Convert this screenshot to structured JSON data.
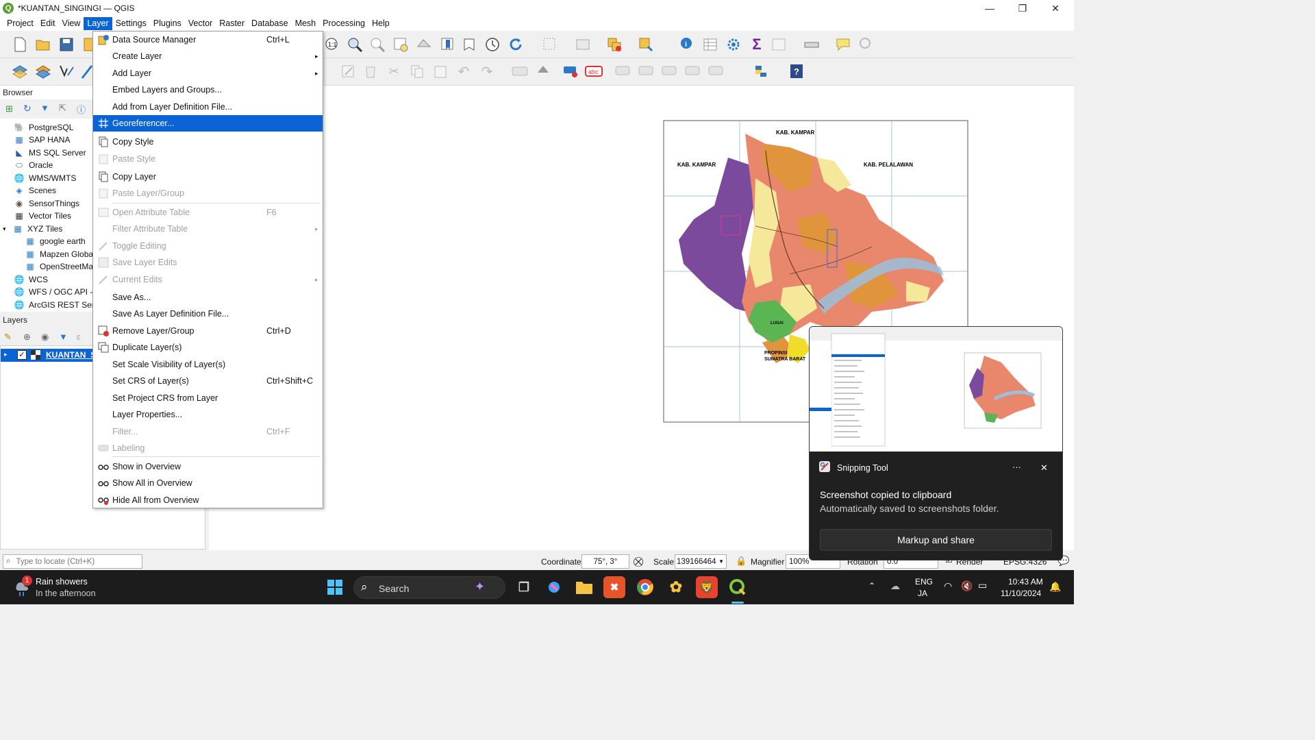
{
  "window": {
    "title": "*KUANTAN_SINGINGI — QGIS",
    "min": "—",
    "max": "❐",
    "close": "✕"
  },
  "menubar": [
    "Project",
    "Edit",
    "View",
    "Layer",
    "Settings",
    "Plugins",
    "Vector",
    "Raster",
    "Database",
    "Mesh",
    "Processing",
    "Help"
  ],
  "browser": {
    "title": "Browser",
    "items": [
      {
        "label": "PostgreSQL",
        "icon": "elephant-icon"
      },
      {
        "label": "SAP HANA",
        "icon": "database-icon"
      },
      {
        "label": "MS SQL Server",
        "icon": "database-icon"
      },
      {
        "label": "Oracle",
        "icon": "database-icon"
      },
      {
        "label": "WMS/WMTS",
        "icon": "globe-icon"
      },
      {
        "label": "Scenes",
        "icon": "scene-icon"
      },
      {
        "label": "SensorThings",
        "icon": "sensor-icon"
      },
      {
        "label": "Vector Tiles",
        "icon": "grid-icon"
      },
      {
        "label": "XYZ Tiles",
        "icon": "grid-icon"
      },
      {
        "label": "google earth",
        "icon": "grid-icon"
      },
      {
        "label": "Mapzen Globa",
        "icon": "grid-icon"
      },
      {
        "label": "OpenStreetMa",
        "icon": "grid-icon"
      },
      {
        "label": "WCS",
        "icon": "globe-icon"
      },
      {
        "label": "WFS / OGC API -",
        "icon": "globe-icon"
      },
      {
        "label": "ArcGIS REST Serv",
        "icon": "globe-icon"
      }
    ]
  },
  "layers": {
    "title": "Layers",
    "layer_name": "KUANTAN_S"
  },
  "layer_menu": {
    "items": [
      {
        "label": "Data Source Manager",
        "shortcut": "Ctrl+L",
        "icon": "data-source-icon"
      },
      {
        "label": "Create Layer",
        "submenu": "▸"
      },
      {
        "label": "Add Layer",
        "submenu": "▸"
      },
      {
        "label": "Embed Layers and Groups..."
      },
      {
        "label": "Add from Layer Definition File..."
      },
      {
        "label": "Georeferencer...",
        "highlight": true,
        "icon": "georeferencer-icon"
      },
      {
        "label": "Copy Style",
        "icon": "copy-icon"
      },
      {
        "label": "Paste Style",
        "disabled": true,
        "icon": "paste-icon"
      },
      {
        "label": "Copy Layer",
        "icon": "copy-icon"
      },
      {
        "label": "Paste Layer/Group",
        "disabled": true,
        "icon": "paste-icon"
      },
      {
        "label": "Open Attribute Table",
        "shortcut": "F6",
        "disabled": true,
        "icon": "table-icon"
      },
      {
        "label": "Filter Attribute Table",
        "submenu": "▸",
        "disabled": true
      },
      {
        "label": "Toggle Editing",
        "disabled": true,
        "icon": "pencil-icon"
      },
      {
        "label": "Save Layer Edits",
        "disabled": true,
        "icon": "save-icon"
      },
      {
        "label": "Current Edits",
        "submenu": "▸",
        "disabled": true,
        "icon": "pencil-icon"
      },
      {
        "label": "Save As..."
      },
      {
        "label": "Save As Layer Definition File..."
      },
      {
        "label": "Remove Layer/Group",
        "shortcut": "Ctrl+D",
        "icon": "remove-layer-icon"
      },
      {
        "label": "Duplicate Layer(s)",
        "icon": "duplicate-icon"
      },
      {
        "label": "Set Scale Visibility of Layer(s)"
      },
      {
        "label": "Set CRS of Layer(s)",
        "shortcut": "Ctrl+Shift+C"
      },
      {
        "label": "Set Project CRS from Layer"
      },
      {
        "label": "Layer Properties..."
      },
      {
        "label": "Filter...",
        "shortcut": "Ctrl+F",
        "disabled": true
      },
      {
        "label": "Labeling",
        "disabled": true,
        "icon": "labeling-icon"
      },
      {
        "label": "Show in Overview",
        "icon": "overview-icon"
      },
      {
        "label": "Show All in Overview",
        "icon": "overview-icon"
      },
      {
        "label": "Hide All from Overview",
        "icon": "overview-hide-icon"
      }
    ]
  },
  "map": {
    "labels": {
      "kab_kampar_1": "KAB. KAMPAR",
      "kab_kampar_2": "KAB. KAMPAR",
      "kab_pelalawan": "KAB. PELALAWAN",
      "propinsi_1": "PROPINSI",
      "propinsi_2": "SUMATRA BARAT",
      "ling": "LUGAI"
    }
  },
  "statusbar": {
    "locate_placeholder": "Type to locate (Ctrl+K)",
    "coordinate_label": "Coordinate",
    "coordinate_value": "75°, 3°",
    "scale_label": "Scale",
    "scale_value": "139166464",
    "magnifier_label": "Magnifier",
    "magnifier_value": "100%",
    "rotation_label": "Rotation",
    "rotation_value": "0.0 °",
    "render_label": "Render",
    "crs": "EPSG:4326"
  },
  "snipping_toast": {
    "app_name": "Snipping Tool",
    "more": "···",
    "close": "✕",
    "headline": "Screenshot copied to clipboard",
    "subtext": "Automatically saved to screenshots folder.",
    "action_button": "Markup and share"
  },
  "taskbar": {
    "weather_badge": "1",
    "weather_title": "Rain showers",
    "weather_sub": "In the afternoon",
    "search_label": "Search",
    "lang_top": "ENG",
    "lang_bottom": "JA",
    "time": "10:43 AM",
    "date": "11/10/2024"
  },
  "colors": {
    "accent": "#0a64d6",
    "map_purple": "#7b4a9c",
    "map_salmon": "#e8876b",
    "map_orange": "#e0953c",
    "map_yellow": "#f5e89a",
    "map_green": "#5ab552",
    "river_blue": "#9bbfdc"
  }
}
